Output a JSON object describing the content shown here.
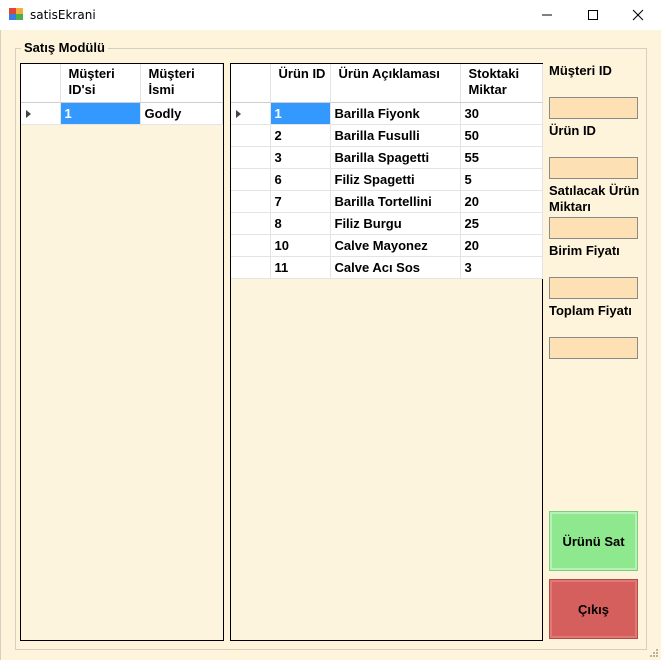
{
  "window": {
    "title": "satisEkrani",
    "icon": "app-form-icon",
    "controls": [
      "minimize-icon",
      "maximize-icon",
      "close-icon"
    ]
  },
  "group": {
    "title": "Satış Modülü"
  },
  "customers_grid": {
    "columns": [
      "Müşteri ID'si",
      "Müşteri İsmi"
    ],
    "rows": [
      {
        "id": "1",
        "name": "Godly"
      }
    ],
    "selected_row": 0
  },
  "products_grid": {
    "columns": [
      "Ürün ID",
      "Ürün Açıklaması",
      "Stoktaki Miktar"
    ],
    "rows": [
      {
        "id": "1",
        "desc": "Barilla Fiyonk",
        "qty": "30"
      },
      {
        "id": "2",
        "desc": "Barilla Fusulli",
        "qty": "50"
      },
      {
        "id": "3",
        "desc": "Barilla Spagetti",
        "qty": "55"
      },
      {
        "id": "6",
        "desc": "Filiz Spagetti",
        "qty": "5"
      },
      {
        "id": "7",
        "desc": "Barilla Tortellini",
        "qty": "20"
      },
      {
        "id": "8",
        "desc": "Filiz Burgu",
        "qty": "25"
      },
      {
        "id": "10",
        "desc": "Calve Mayonez",
        "qty": "20"
      },
      {
        "id": "11",
        "desc": "Calve Acı Sos",
        "qty": "3"
      }
    ],
    "selected_row": 0
  },
  "form": {
    "customer_id_label": "Müşteri ID",
    "customer_id_value": "",
    "product_id_label": "Ürün ID",
    "product_id_value": "",
    "quantity_label": "Satılacak Ürün Miktarı",
    "quantity_value": "",
    "unit_price_label": "Birim Fiyatı",
    "unit_price_value": "",
    "total_price_label": "Toplam Fiyatı",
    "total_price_value": ""
  },
  "buttons": {
    "sell_label": "Ürünü Sat",
    "exit_label": "Çıkış"
  },
  "colors": {
    "background": "#fef4dc",
    "input": "#fde0b3",
    "sell_button": "#8ee88e",
    "exit_button": "#d45f5c",
    "selection": "#3399ff"
  }
}
